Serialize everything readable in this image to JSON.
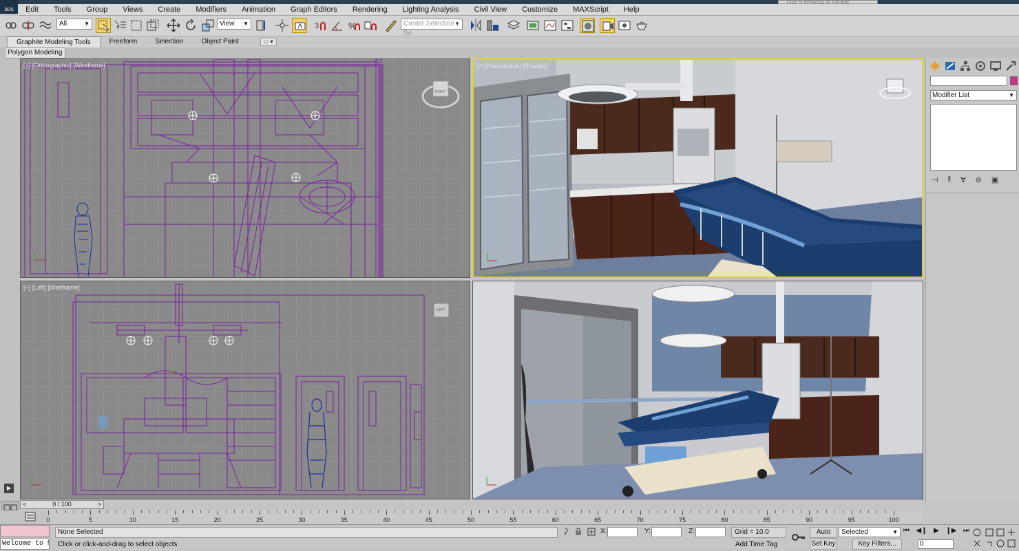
{
  "window": {
    "search_placeholder": "Type a keyword or phrase",
    "app_logo": "3DS"
  },
  "menu": [
    "Edit",
    "Tools",
    "Group",
    "Views",
    "Create",
    "Modifiers",
    "Animation",
    "Graph Editors",
    "Rendering",
    "Lighting Analysis",
    "Civil View",
    "Customize",
    "MAXScript",
    "Help"
  ],
  "toolbar": {
    "selection_filter": "All",
    "ref_coord": "View",
    "named_selection_placeholder": "Create Selection Se"
  },
  "ribbon": {
    "tabs": [
      "Graphite Modeling Tools",
      "Freeform",
      "Selection",
      "Object Paint"
    ],
    "active_tab": "Graphite Modeling Tools",
    "panel": "Polygon Modeling"
  },
  "viewports": {
    "top_left": "[+] [Orthographic] [Wireframe]",
    "top_right": "[+] [Perspective] [Shaded]",
    "bottom_left": "[+] [Left] [Wireframe]",
    "bottom_right": "",
    "viewcube_tl": "RIGHT",
    "viewcube_bl": "LEFT",
    "wire_color": "#7a1fa2",
    "active_border": "#e4d31e"
  },
  "command_panel": {
    "modifier_list": "Modifier List",
    "object_color": "#cc3388"
  },
  "time": {
    "frame_display": "0 / 100",
    "ticks": [
      0,
      5,
      10,
      15,
      20,
      25,
      30,
      35,
      40,
      45,
      50,
      55,
      60,
      65,
      70,
      75,
      80,
      85,
      90,
      95,
      100
    ]
  },
  "status": {
    "maxscript_listener": "Welcome to M",
    "selection": "None Selected",
    "prompt": "Click or click-and-drag to select objects",
    "x_label": "X:",
    "y_label": "Y:",
    "z_label": "Z:",
    "grid": "Grid = 10.0",
    "add_time_tag": "Add Time Tag",
    "auto_key": "Auto Key",
    "set_key": "Set Key",
    "key_mode": "Selected",
    "key_filters": "Key Filters...",
    "current_frame": "0"
  }
}
